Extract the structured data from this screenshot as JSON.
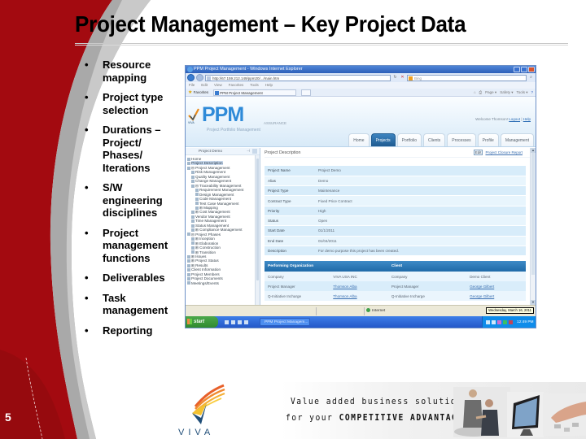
{
  "slide": {
    "title": "Project Management – Key Project Data",
    "page_number": "5",
    "bullets": [
      "Resource mapping",
      "Project type selection",
      "Durations – Project/ Phases/ Iterations",
      "S/W engineering disciplines",
      "Project management functions",
      "Deliverables",
      "Task management",
      "Reporting"
    ],
    "logo_text": "VIVA",
    "banner": {
      "line1": "Value added business solutions",
      "line2_prefix": "for your ",
      "line2_emphasis": "COMPETITIVE ADVANTAGE"
    }
  },
  "browser": {
    "window_title": "PPM Project Management - Windows Internet Explorer",
    "address": "http://67.159.212.149/ppm20/.../main.htm",
    "search_placeholder": "Bing",
    "menu": [
      "File",
      "Edit",
      "View",
      "Favorites",
      "Tools",
      "Help"
    ],
    "favorites_label": "Favorites",
    "tab_label": "PPM Project Management",
    "command_bar": [
      "Page ▾",
      "Safety ▾",
      "Tools ▾"
    ],
    "status_zone": "Internet",
    "tooltip": "Wednesday, March 16, 2011",
    "taskbar": {
      "start_label": "start",
      "task_label": "PPM Project Managem...",
      "clock": "12:49 PM"
    }
  },
  "app": {
    "logo": "PPM",
    "subtitle": "Project Portfolio Management",
    "version": "ASSURANCE",
    "welcome": "Welcome Thomson!",
    "logout": "Logout",
    "help": "Help",
    "tabs": [
      {
        "label": "Home",
        "active": false
      },
      {
        "label": "Projects",
        "active": true
      },
      {
        "label": "Portfolio",
        "active": false
      },
      {
        "label": "Clients",
        "active": false
      },
      {
        "label": "Processes",
        "active": false
      },
      {
        "label": "Profile",
        "active": false
      },
      {
        "label": "Management",
        "active": false
      }
    ],
    "tree": {
      "title": "Project Demo",
      "items": [
        {
          "label": "Home",
          "indent": 0,
          "selected": false
        },
        {
          "label": "Project Description",
          "indent": 0,
          "selected": true
        },
        {
          "label": "⊟ Project Management",
          "indent": 0,
          "selected": false
        },
        {
          "label": "Risk Management",
          "indent": 1,
          "selected": false
        },
        {
          "label": "Quality Management",
          "indent": 1,
          "selected": false
        },
        {
          "label": "Change Management",
          "indent": 1,
          "selected": false
        },
        {
          "label": "⊟ Traceability Management",
          "indent": 1,
          "selected": false
        },
        {
          "label": "Requirement Management",
          "indent": 2,
          "selected": false
        },
        {
          "label": "Design Management",
          "indent": 2,
          "selected": false
        },
        {
          "label": "Code Management",
          "indent": 2,
          "selected": false
        },
        {
          "label": "Test Case Management",
          "indent": 2,
          "selected": false
        },
        {
          "label": "⊞ Mapping",
          "indent": 2,
          "selected": false
        },
        {
          "label": "⊞ Cost Management",
          "indent": 1,
          "selected": false
        },
        {
          "label": "Vendor Management",
          "indent": 1,
          "selected": false
        },
        {
          "label": "Time Management",
          "indent": 1,
          "selected": false
        },
        {
          "label": "Status Management",
          "indent": 1,
          "selected": false
        },
        {
          "label": "⊞ Compliance Management",
          "indent": 1,
          "selected": false
        },
        {
          "label": "⊟ Project Phases",
          "indent": 0,
          "selected": false
        },
        {
          "label": "⊞ Inception",
          "indent": 1,
          "selected": false
        },
        {
          "label": "⊞ Elaboration",
          "indent": 1,
          "selected": false
        },
        {
          "label": "⊞ Construction",
          "indent": 1,
          "selected": false
        },
        {
          "label": "⊞ Transition",
          "indent": 1,
          "selected": false
        },
        {
          "label": "⊞ Issues",
          "indent": 0,
          "selected": false
        },
        {
          "label": "⊞ Project Status",
          "indent": 0,
          "selected": false
        },
        {
          "label": "⊞ Results",
          "indent": 0,
          "selected": false
        },
        {
          "label": "Client Information",
          "indent": 0,
          "selected": false
        },
        {
          "label": "Project Members",
          "indent": 0,
          "selected": false
        },
        {
          "label": "Project Documents",
          "indent": 0,
          "selected": false
        },
        {
          "label": "Meetings/Events",
          "indent": 0,
          "selected": false
        }
      ]
    },
    "content": {
      "heading": "Project Description",
      "edit_label": "Edit",
      "report_link": "Project Closure Report",
      "details": [
        {
          "key": "Project Name",
          "value": "Project Demo"
        },
        {
          "key": "Alias",
          "value": "Demo"
        },
        {
          "key": "Project Type",
          "value": "Maintenance"
        },
        {
          "key": "Contract Type",
          "value": "Fixed Price Contract"
        },
        {
          "key": "Priority",
          "value": "High"
        },
        {
          "key": "Status",
          "value": "Open"
        },
        {
          "key": "Start Date",
          "value": "01/1/2011"
        },
        {
          "key": "End Date",
          "value": "01/04/2011"
        },
        {
          "key": "Description",
          "value": "For demo purpose this project has been created."
        }
      ],
      "org_headers": [
        "Performing Organization",
        "",
        "Client",
        ""
      ],
      "org_rows": [
        [
          "Company",
          "VIVA USA INC",
          "Company",
          "Demo Client"
        ],
        [
          "Project Manager",
          "Thomson Alba",
          "Project Manager",
          "George Gilbert"
        ],
        [
          "Q-Initiative Incharge",
          "Thomson Alba",
          "Q-Initiative Incharge",
          "George Gilbert"
        ]
      ]
    }
  }
}
